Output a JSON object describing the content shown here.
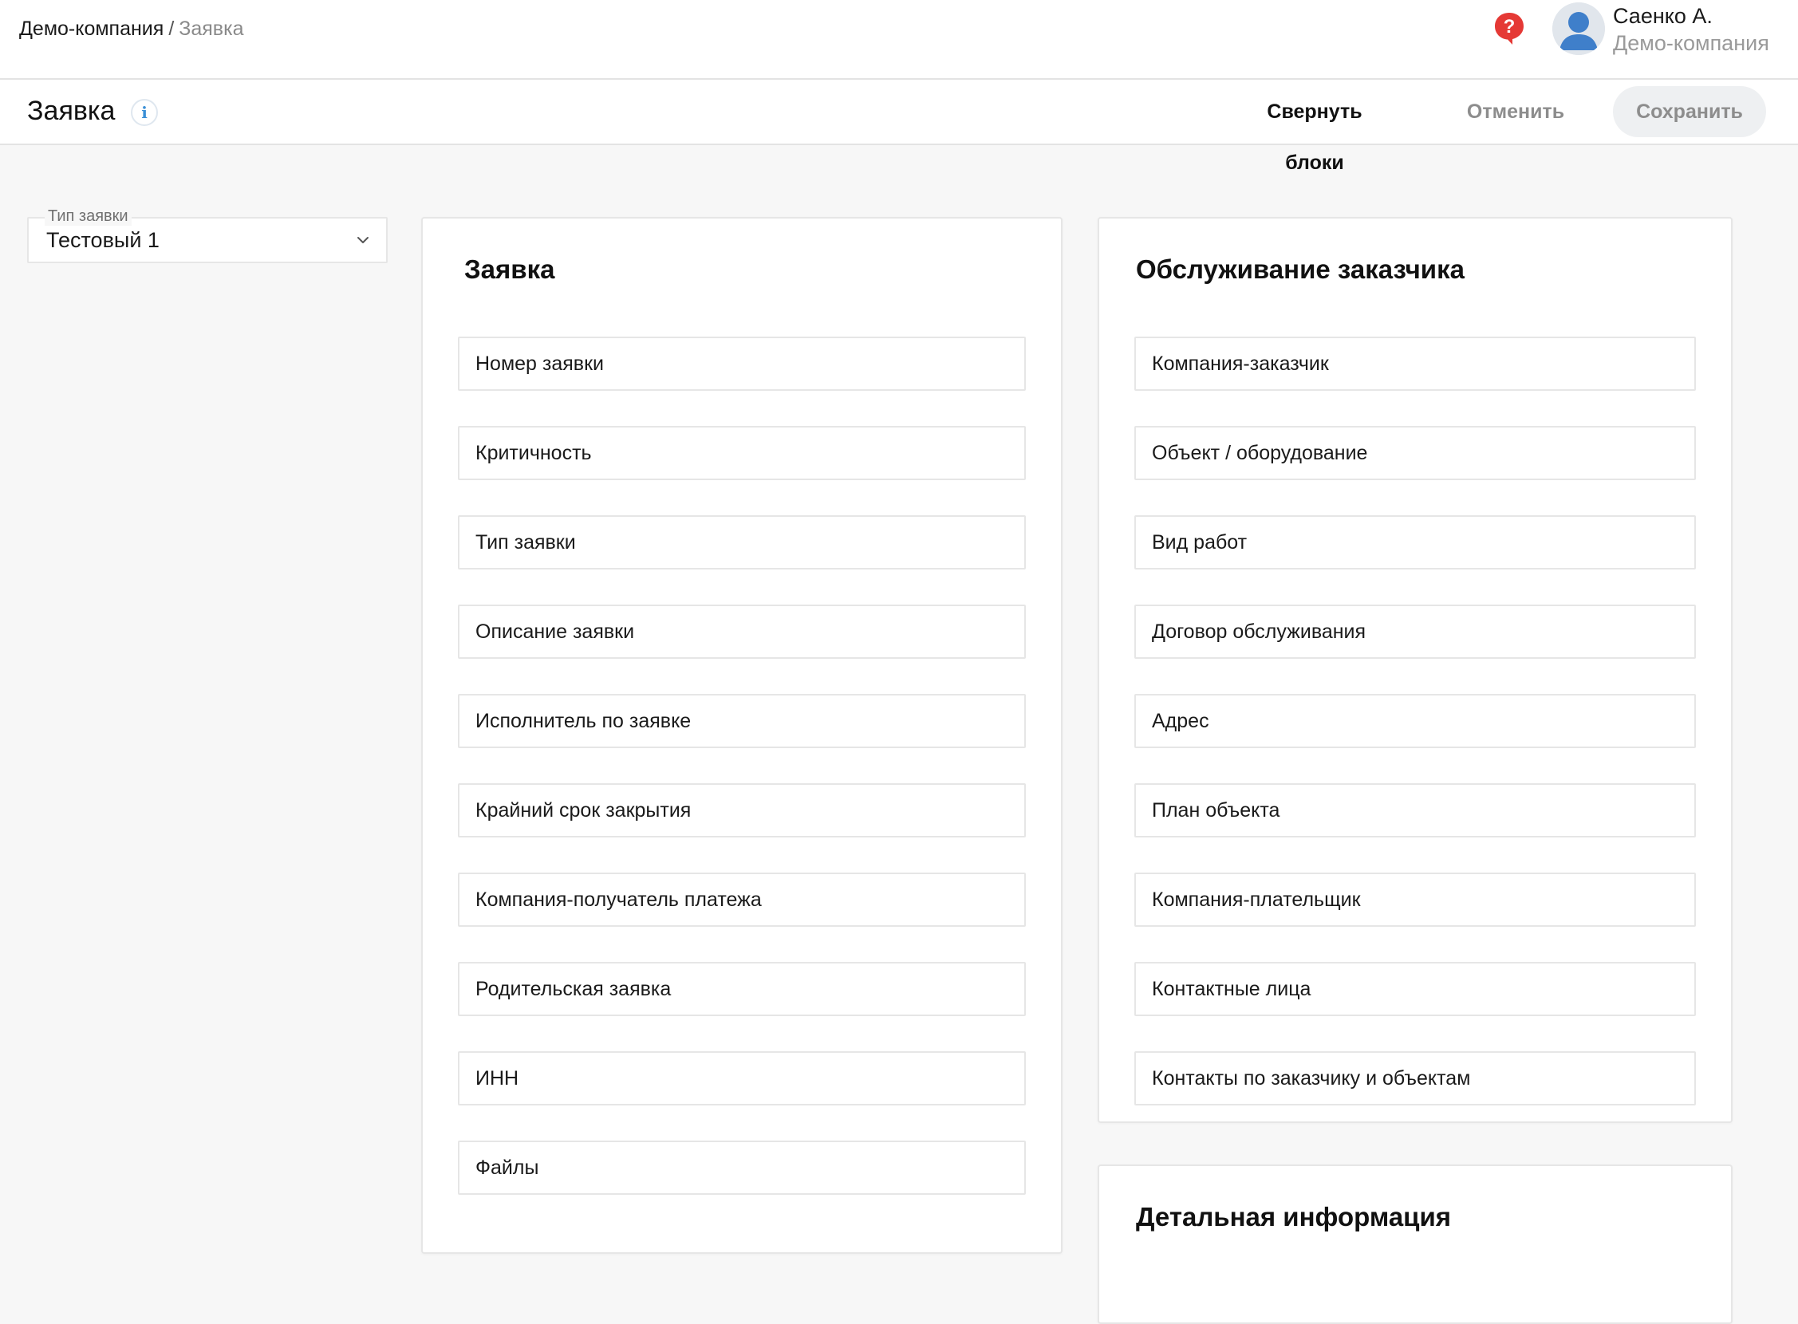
{
  "header": {
    "breadcrumb": {
      "root": "Демо-компания",
      "separator": "/",
      "current": "Заявка"
    },
    "help_icon": "help-question-icon",
    "user": {
      "name": "Саенко А.",
      "company": "Демо-компания",
      "avatar_icon": "user-avatar-icon"
    }
  },
  "toolbar": {
    "title": "Заявка",
    "info_icon_glyph": "i",
    "collapse_label": "Свернуть блоки",
    "cancel_label": "Отменить",
    "save_label": "Сохранить"
  },
  "request_type": {
    "label": "Тип заявки",
    "value": "Тестовый 1"
  },
  "cards": {
    "request": {
      "title": "Заявка",
      "fields": [
        "Номер заявки",
        "Критичность",
        "Тип заявки",
        "Описание заявки",
        "Исполнитель по заявке",
        "Крайний срок закрытия",
        "Компания-получатель платежа",
        "Родительская заявка",
        "ИНН",
        "Файлы"
      ]
    },
    "customer_service": {
      "title": "Обслуживание заказчика",
      "fields": [
        "Компания-заказчик",
        "Объект / оборудование",
        "Вид работ",
        "Договор обслуживания",
        "Адрес",
        "План объекта",
        "Компания-плательщик",
        "Контактные лица",
        "Контакты по заказчику и объектам"
      ]
    },
    "details": {
      "title": "Детальная информация"
    }
  },
  "colors": {
    "accent_help": "#e53935",
    "info_blue": "#3a8fd6",
    "muted_text": "#8d8d8d",
    "background": "#f7f7f7"
  }
}
